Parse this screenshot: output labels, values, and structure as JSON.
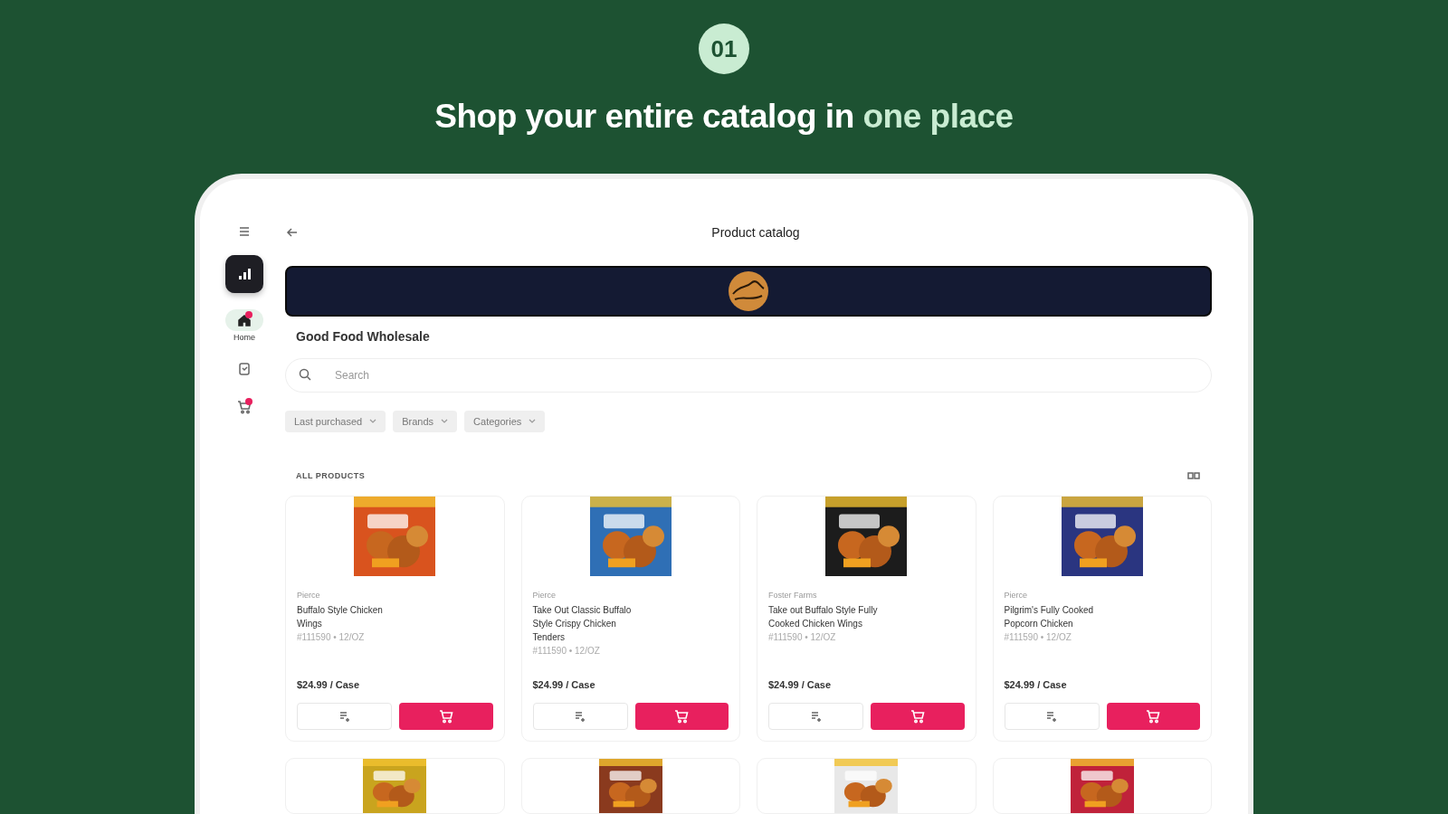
{
  "step_badge": "01",
  "headline": {
    "lead": "Shop your entire catalog in ",
    "highlight": "one place"
  },
  "sidebar": {
    "items": [
      {
        "kind": "home",
        "label": "Home",
        "selected": true,
        "notification": true
      },
      {
        "kind": "orders",
        "selected": false,
        "notification": false
      },
      {
        "kind": "cart",
        "selected": false,
        "notification": true
      }
    ]
  },
  "header": {
    "title": "Product catalog"
  },
  "supplier": {
    "name": "Good Food Wholesale"
  },
  "search": {
    "placeholder": "Search"
  },
  "filters": [
    {
      "label": "Last purchased"
    },
    {
      "label": "Brands"
    },
    {
      "label": "Categories"
    }
  ],
  "section": {
    "title": "ALL PRODUCTS"
  },
  "products": [
    {
      "brand": "Pierce",
      "name": "Buffalo Style Chicken Wings",
      "sku": "#111590 • 12/OZ",
      "price": "$24.99 / Case"
    },
    {
      "brand": "Pierce",
      "name": "Take Out Classic Buffalo Style Crispy Chicken Tenders",
      "sku": "#111590 • 12/OZ",
      "price": "$24.99 / Case"
    },
    {
      "brand": "Foster Farms",
      "name": "Take out Buffalo Style Fully Cooked Chicken Wings",
      "sku": "#111590 • 12/OZ",
      "price": "$24.99 / Case"
    },
    {
      "brand": "Pierce",
      "name": "Pilgrim's Fully Cooked Popcorn Chicken",
      "sku": "#111590 • 12/OZ",
      "price": "$24.99 / Case"
    }
  ]
}
